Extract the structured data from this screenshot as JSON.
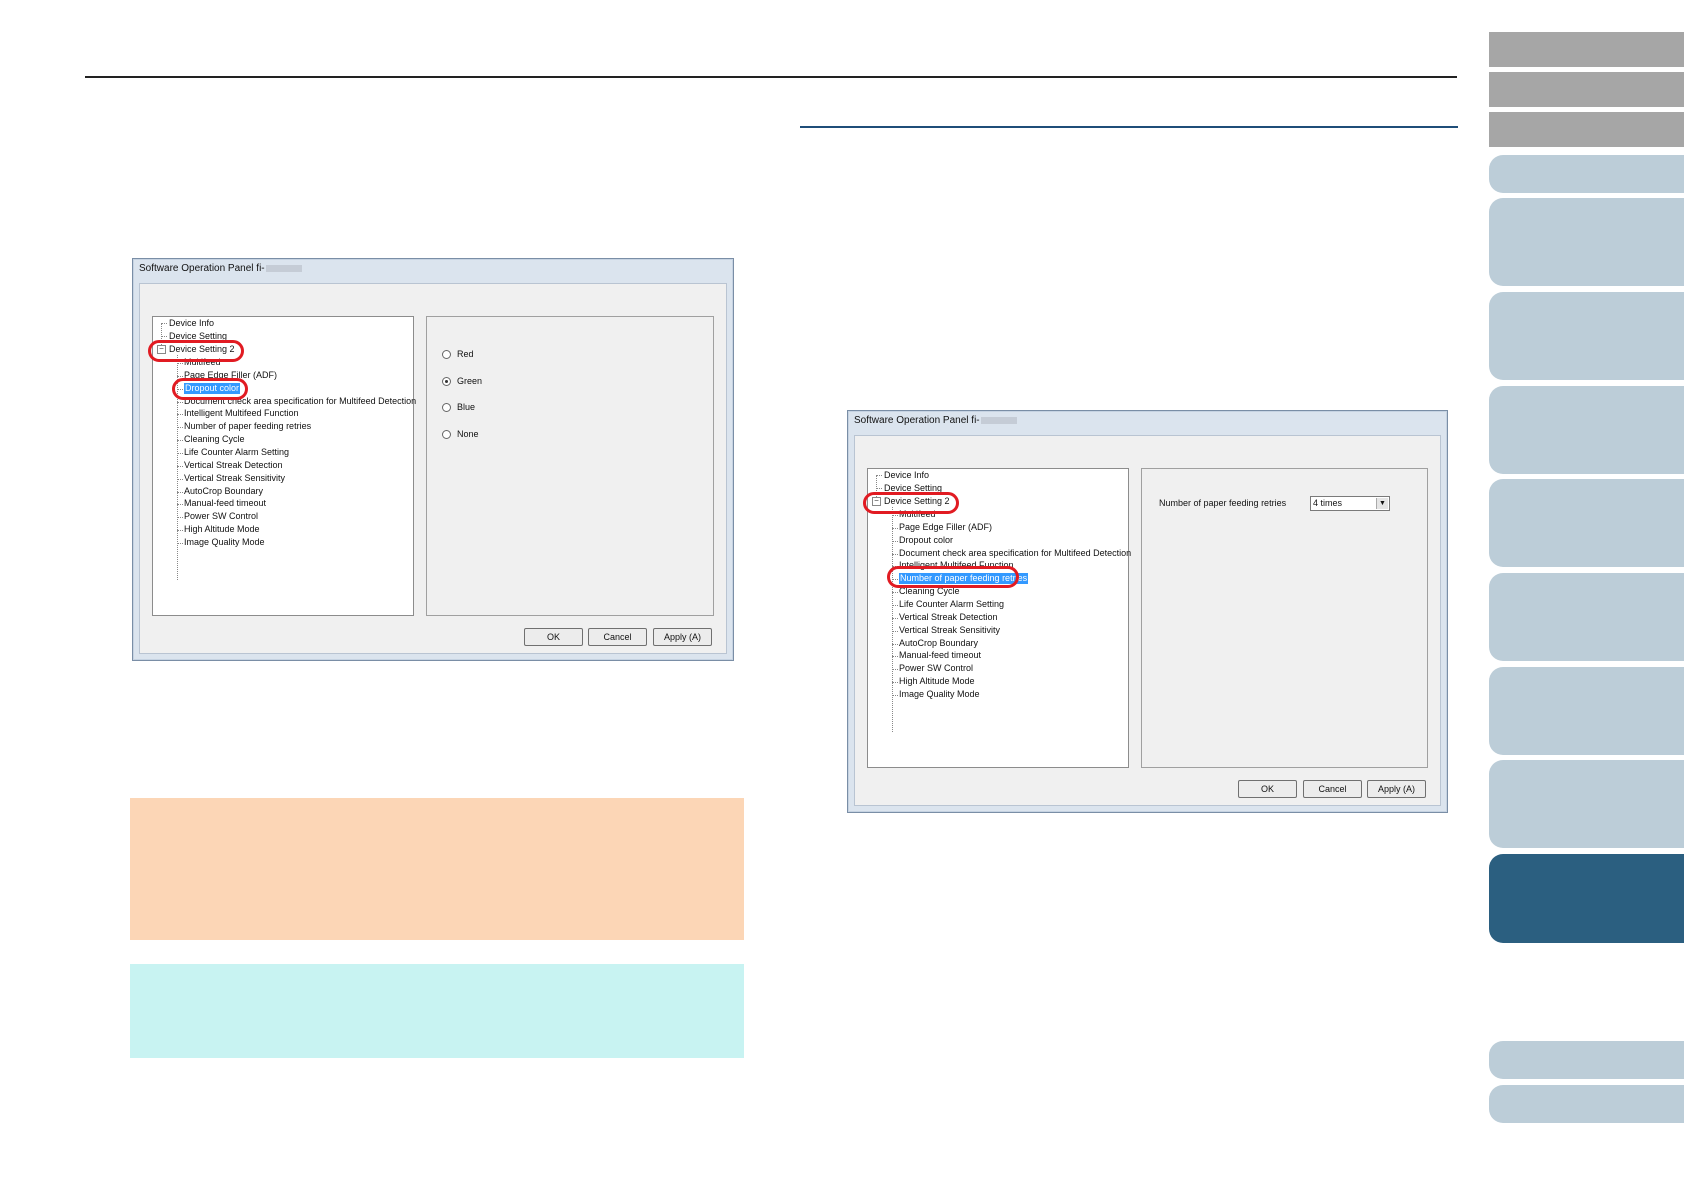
{
  "dialog1": {
    "title": "Software Operation Panel fi-",
    "tree": {
      "device_info": "Device Info",
      "device_setting": "Device Setting",
      "device_setting_2": "Device Setting 2",
      "children": [
        "Multifeed",
        "Page Edge Filler (ADF)",
        "Dropout color",
        "Document check area specification for Multifeed Detection",
        "Intelligent Multifeed Function",
        "Number of paper feeding retries",
        "Cleaning Cycle",
        "Life Counter Alarm Setting",
        "Vertical Streak Detection",
        "Vertical Streak Sensitivity",
        "AutoCrop Boundary",
        "Manual-feed timeout",
        "Power SW Control",
        "High Altitude Mode",
        "Image Quality Mode"
      ],
      "selected_index": 2
    },
    "radios": [
      {
        "label": "Red",
        "checked": false
      },
      {
        "label": "Green",
        "checked": true
      },
      {
        "label": "Blue",
        "checked": false
      },
      {
        "label": "None",
        "checked": false
      }
    ],
    "buttons": {
      "ok": "OK",
      "cancel": "Cancel",
      "apply": "Apply (A)"
    }
  },
  "dialog2": {
    "title": "Software Operation Panel fi-",
    "tree": {
      "device_info": "Device Info",
      "device_setting": "Device Setting",
      "device_setting_2": "Device Setting 2",
      "children": [
        "Multifeed",
        "Page Edge Filler (ADF)",
        "Dropout color",
        "Document check area specification for Multifeed Detection",
        "Intelligent Multifeed Function",
        "Number of paper feeding retries",
        "Cleaning Cycle",
        "Life Counter Alarm Setting",
        "Vertical Streak Detection",
        "Vertical Streak Sensitivity",
        "AutoCrop Boundary",
        "Manual-feed timeout",
        "Power SW Control",
        "High Altitude Mode",
        "Image Quality Mode"
      ],
      "selected_index": 5
    },
    "field_label": "Number of paper feeding retries",
    "combo_value": "4 times",
    "buttons": {
      "ok": "OK",
      "cancel": "Cancel",
      "apply": "Apply (A)"
    }
  },
  "colors": {
    "highlight": "#e11b22",
    "selection": "#3399ff",
    "tab_light": "#bccdd8",
    "tab_dark": "#2b5f80",
    "tab_gray": "#a6a6a6",
    "note_orange": "#fcd6b6",
    "note_cyan": "#c8f3f2"
  }
}
